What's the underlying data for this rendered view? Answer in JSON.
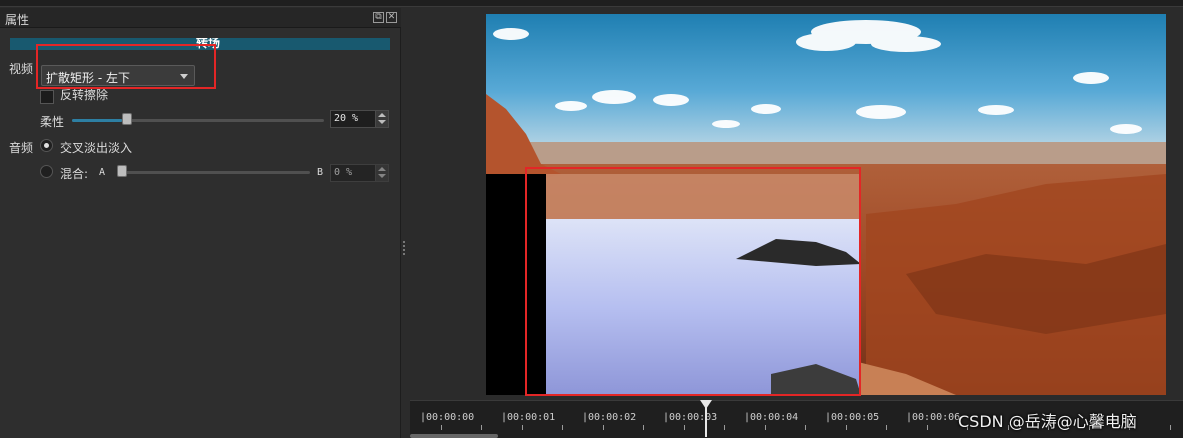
{
  "panel": {
    "title": "属性",
    "transition_label": "转场",
    "video": {
      "label": "视频",
      "effect_value": "扩散矩形 - 左下",
      "reverse_label": "反转擦除",
      "softness_label": "柔性",
      "softness_value": "20 %",
      "softness_fraction": 0.2
    },
    "audio": {
      "label": "音频",
      "crossfade_label": "交叉淡出淡入",
      "mix_label": "混合:",
      "mix_a": "A",
      "mix_b": "B",
      "mix_value": "0 %",
      "mix_fraction": 0.0
    }
  },
  "timeline": {
    "ticks": [
      "|00:00:00",
      "|00:00:01",
      "|00:00:02",
      "|00:00:03",
      "|00:00:04",
      "|00:00:05",
      "|00:00:06"
    ]
  },
  "watermark": "CSDN @岳涛@心馨电脑",
  "colors": {
    "highlight_box": "#e32626",
    "transition_bar": "#18596f",
    "slider_accent": "#2d7fa3"
  },
  "icons": [
    "float-icon",
    "close-icon",
    "dropdown-arrow-icon",
    "spin-up-icon",
    "spin-down-icon",
    "playhead-icon"
  ]
}
